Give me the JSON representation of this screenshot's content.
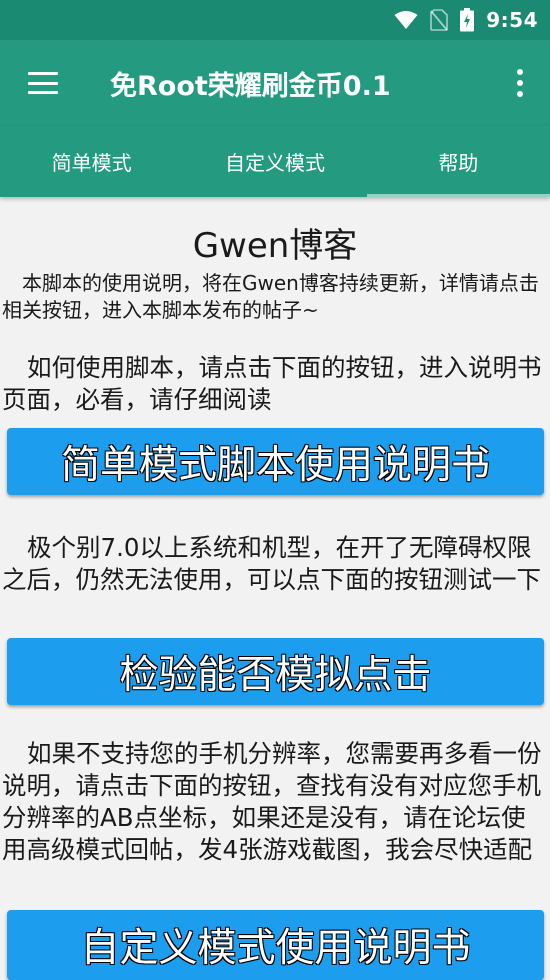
{
  "status_bar": {
    "time": "9:54",
    "icons": [
      "wifi-icon",
      "no-sim-icon",
      "battery-charging-icon"
    ]
  },
  "app_bar": {
    "title": "免Root荣耀刷金币0.1",
    "menu_icon": "hamburger-menu-icon",
    "overflow_icon": "more-vert-icon"
  },
  "tabs": [
    {
      "label": "简单模式",
      "active": false
    },
    {
      "label": "自定义模式",
      "active": false
    },
    {
      "label": "帮助",
      "active": true
    }
  ],
  "content": {
    "blog_title": "Gwen博客",
    "intro": "本脚本的使用说明，将在Gwen博客持续更新，详情请点击相关按钮，进入本脚本发布的帖子~",
    "para1": "如何使用脚本，请点击下面的按钮，进入说明书页面，必看，请仔细阅读",
    "button1": "简单模式脚本使用说明书",
    "para2": "极个别7.0以上系统和机型，在开了无障碍权限之后，仍然无法使用，可以点下面的按钮测试一下",
    "button2": "检验能否模拟点击",
    "para3": "如果不支持您的手机分辨率，您需要再多看一份说明，请点击下面的按钮，查找有没有对应您手机分辨率的AB点坐标，如果还是没有，请在论坛使用高级模式回帖，发4张游戏截图，我会尽快适配",
    "button3": "自定义模式使用说明书"
  },
  "colors": {
    "status_bar": "#1b8a72",
    "primary": "#249b80",
    "tab_indicator": "#8fd4c4",
    "button": "#1c9ded",
    "background": "#f2f2f2"
  }
}
